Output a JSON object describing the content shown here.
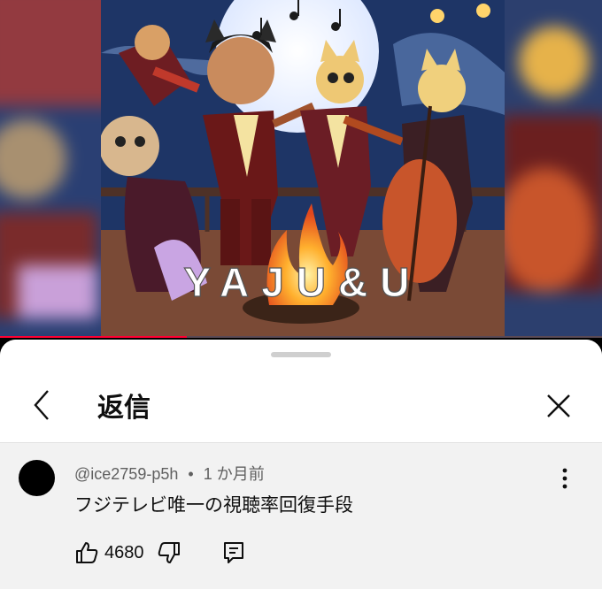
{
  "video": {
    "overlay_text": "YAJU&U",
    "progress": 0.31
  },
  "sheet": {
    "title": "返信",
    "back_icon": "chevron-left-icon",
    "close_icon": "close-icon"
  },
  "comment": {
    "author": "@ice2759-p5h",
    "separator": "•",
    "time": "1 か月前",
    "text": "フジテレビ唯一の視聴率回復手段",
    "like_count": "4680",
    "like_icon": "thumbs-up-icon",
    "dislike_icon": "thumbs-down-icon",
    "reply_icon": "comment-reply-icon",
    "more_icon": "more-vert-icon"
  },
  "colors": {
    "progress": "#ff0033",
    "sheet_bg": "#f2f2f2",
    "header_bg": "#ffffff",
    "meta_text": "#606060"
  }
}
